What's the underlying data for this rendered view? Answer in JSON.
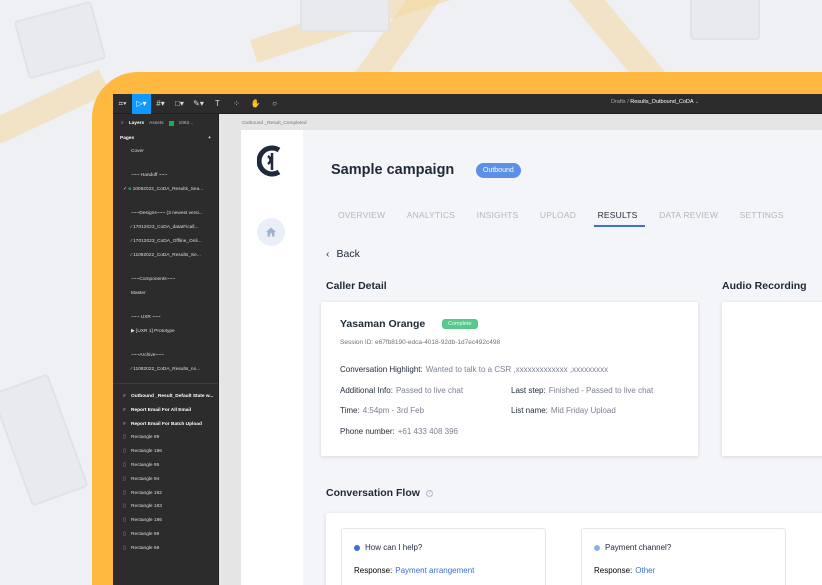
{
  "figma": {
    "breadcrumb_parent": "Drafts",
    "breadcrumb_sep": "/",
    "file_name": "Results_Outbound_CoDA",
    "panel_tabs": {
      "layers": "Layers",
      "assets": "Assets",
      "page_short": "1062..."
    },
    "pages_label": "Pages",
    "add_page": "+",
    "pages": [
      "Cover",
      "~~~ Handoff ~~~",
      "10062022_CoDA_Results_Sea...",
      "~~~Designs~~~ (3 newest versi...",
      "17012023_CoDA_dataIFicall...",
      "17012023_CoDA_Offline_Onli...",
      "11082022_CoDA_Results_Se...",
      "~~~Components~~~",
      "Master",
      "~~~ UXR ~~~",
      "[UXR 1] Prototype",
      "~~~Archive~~~",
      "11082022_CoDA_Results_no..."
    ],
    "layers": [
      "Outbound _Result_Default State w...",
      "Report Email For All Email",
      "Report Email For Batch Upload",
      "Rectangle 99",
      "Rectangle 186",
      "Rectangle 95",
      "Rectangle 94",
      "Rectangle 182",
      "Rectangle 183",
      "Rectangle 186",
      "Rectangle 99",
      "Rectangle 98"
    ],
    "frame_label": "Outbound _Result_Completed"
  },
  "app": {
    "campaign_title": "Sample campaign",
    "campaign_badge": "Outbound",
    "tabs": [
      "OVERVIEW",
      "ANALYTICS",
      "INSIGHTS",
      "UPLOAD",
      "RESULTS",
      "DATA REVIEW",
      "SETTINGS"
    ],
    "active_tab": "RESULTS",
    "back_label": "Back",
    "caller_detail_title": "Caller Detail",
    "audio_recording_title": "Audio Recording",
    "caller": {
      "name": "Yasaman Orange",
      "status": "Complete",
      "session": "Session ID: e67fb8190-edca-4018-92db-1d7ec492c498",
      "highlight_label": "Conversation Highlight:",
      "highlight_value": "Wanted to talk to a CSR ,xxxxxxxxxxxxx ,xxxxxxxxx",
      "additional_label": "Additional Info:",
      "additional_value": "Passed to live chat",
      "last_step_label": "Last step:",
      "last_step_value": "Finished - Passed to live chat",
      "time_label": "Time:",
      "time_value": "4:54pm - 3rd Feb",
      "list_label": "List name:",
      "list_value": "Mid Friday Upload",
      "phone_label": "Phone number:",
      "phone_value": "+61 433 408 396"
    },
    "conversation_flow_title": "Conversation Flow",
    "flow": [
      {
        "question": "How can I help?",
        "response_label": "Response:",
        "response_value": "Payment arrangement"
      },
      {
        "question": "Payment channel?",
        "response_label": "Response:",
        "response_value": "Other"
      }
    ]
  },
  "colors": {
    "accent": "#3e6fd8",
    "frame": "#ffb940",
    "complete": "#58c98c"
  }
}
